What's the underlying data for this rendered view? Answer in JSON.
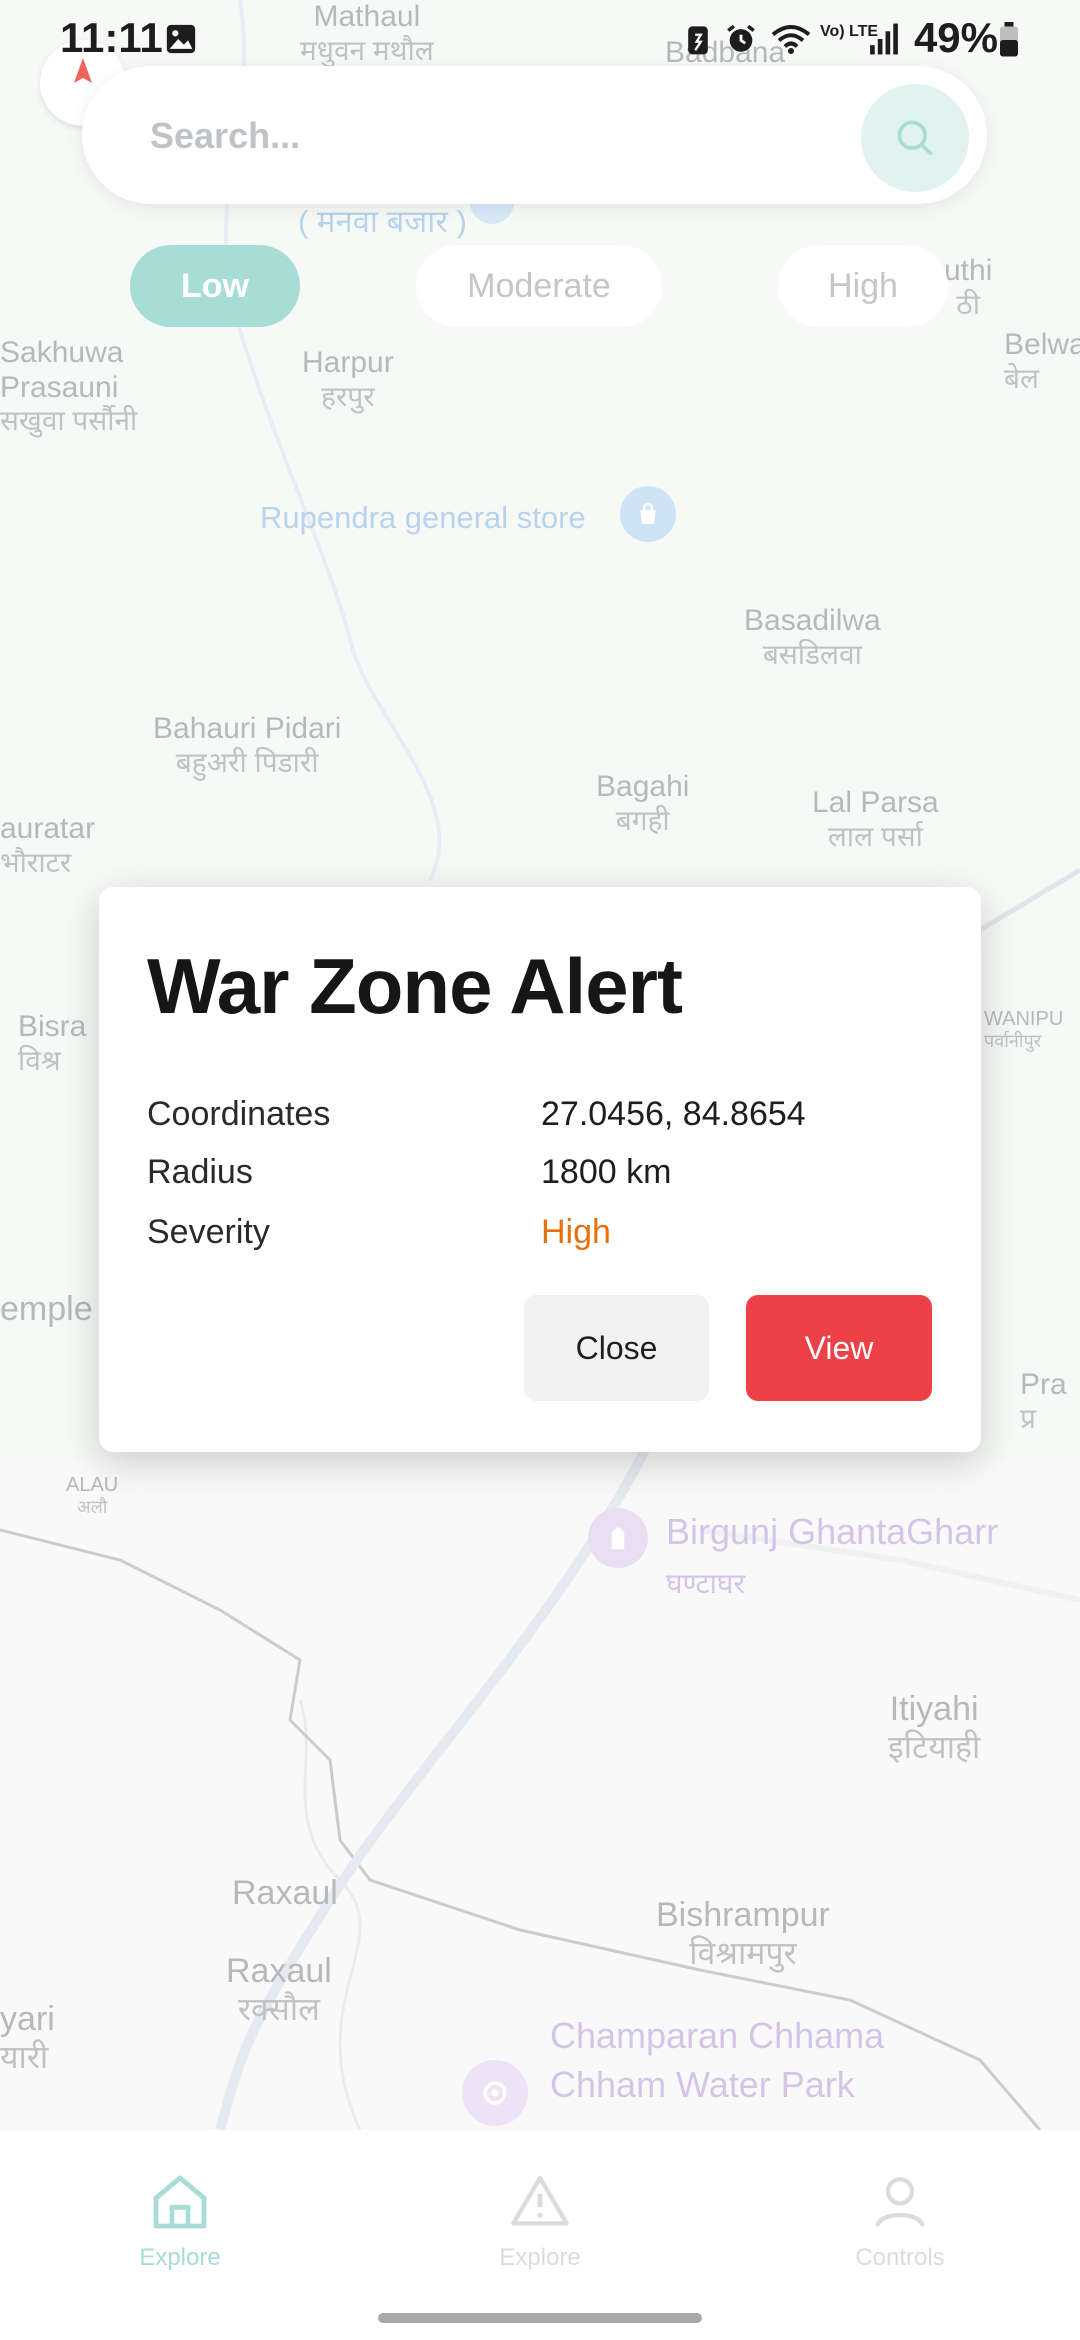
{
  "status_bar": {
    "time": "11:11",
    "battery": "49%",
    "network": "Vo) LTE"
  },
  "search": {
    "placeholder": "Search...",
    "value": ""
  },
  "filters": {
    "chips": [
      {
        "label": "Low",
        "selected": true
      },
      {
        "label": "Moderate",
        "selected": false
      },
      {
        "label": "High",
        "selected": false
      }
    ]
  },
  "map": {
    "places": [
      {
        "en": "Mathaul",
        "hi": "मधुवन मथौल"
      },
      {
        "en": "Badbana",
        "hi": ""
      },
      {
        "en": "Sakhuwa Prasauni",
        "hi": "सखुवा पर्सौनी"
      },
      {
        "en": "Harpur",
        "hi": "हरपुर"
      },
      {
        "en": "Basadilwa",
        "hi": "बसडिलवा"
      },
      {
        "en": "Bahauri Pidari",
        "hi": "बहुअरी पिडारी"
      },
      {
        "en": "Bagahi",
        "hi": "बगही"
      },
      {
        "en": "Lal Parsa",
        "hi": "लाल पर्सा"
      },
      {
        "en": "auratar",
        "hi": "भौराटर"
      },
      {
        "en": "Bisra",
        "hi": "विश्र"
      },
      {
        "en": "WANIPU",
        "hi": "पर्वानीपुर"
      },
      {
        "en": "emple",
        "hi": ""
      },
      {
        "en": "Pra",
        "hi": "प्र"
      },
      {
        "en": "ALAU",
        "hi": "अलौ"
      },
      {
        "en": "Itiyahi",
        "hi": "इटियाही"
      },
      {
        "en": "Raxaul",
        "hi": ""
      },
      {
        "en": "Raxaul",
        "hi": "रक्सौल"
      },
      {
        "en": "Bishrampur",
        "hi": "विश्रामपुर"
      },
      {
        "en": "yari",
        "hi": "यारी"
      },
      {
        "en": "uthi",
        "hi": "ठी"
      },
      {
        "en": "Belwa",
        "hi": "बेल"
      }
    ],
    "pois": {
      "manwa": "( मनवा बजार )",
      "store": "Rupendra general store",
      "ghantaghar_en": "Birgunj GhantaGharr",
      "ghantaghar_hi": "घण्टाघर",
      "waterpark_line1": "Champaran Chhama",
      "waterpark_line2": "Chham Water Park"
    }
  },
  "dialog": {
    "title": "War Zone Alert",
    "rows": [
      {
        "label": "Coordinates",
        "value": "27.0456, 84.8654"
      },
      {
        "label": "Radius",
        "value": "1800 km"
      },
      {
        "label": "Severity",
        "value": "High"
      }
    ],
    "close_label": "Close",
    "view_label": "View",
    "severity_color": "#e8700c",
    "view_color": "#ee4047"
  },
  "bottom_nav": {
    "items": [
      {
        "label": "Explore",
        "icon": "home-icon",
        "active": true
      },
      {
        "label": "Explore",
        "icon": "warning-icon",
        "active": false
      },
      {
        "label": "Controls",
        "icon": "user-icon",
        "active": false
      }
    ],
    "active_color": "#a8dcd6"
  }
}
